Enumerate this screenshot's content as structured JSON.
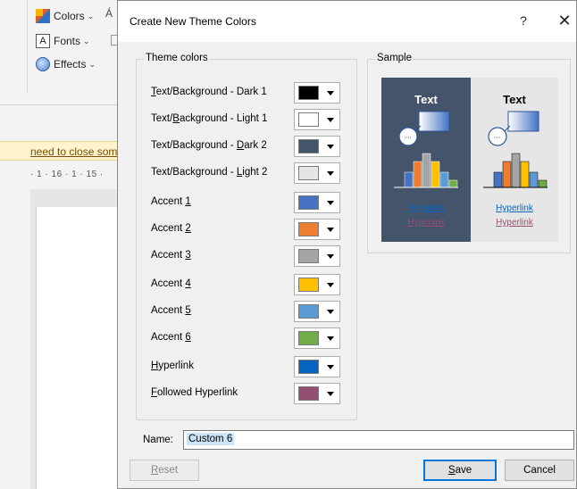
{
  "background_app": {
    "ribbon": {
      "colors_label": "Colors",
      "fonts_label": "Fonts",
      "effects_label": "Effects",
      "colors_icon": "theme-colors-icon",
      "fonts_icon": "theme-fonts-icon",
      "effects_icon": "theme-effects-icon"
    },
    "message_bar_text": "need to close som",
    "ruler_text": "· 1 · 16 · 1 · 15 ·"
  },
  "dialog": {
    "title": "Create New Theme Colors",
    "help_label": "?",
    "close_label": "✕",
    "theme_group_label": "Theme colors",
    "sample_group_label": "Sample",
    "rows": [
      {
        "pre": "",
        "key": "T",
        "post": "ext/Background - Dark 1",
        "color": "#000000"
      },
      {
        "pre": "Text/",
        "key": "B",
        "post": "ackground - Light 1",
        "color": "#ffffff"
      },
      {
        "pre": "Text/Background - ",
        "key": "D",
        "post": "ark 2",
        "color": "#44546a"
      },
      {
        "pre": "Text/Background - ",
        "key": "L",
        "post": "ight 2",
        "color": "#e7e6e6"
      },
      {
        "pre": "Accent ",
        "key": "1",
        "post": "",
        "color": "#4472c4"
      },
      {
        "pre": "Accent ",
        "key": "2",
        "post": "",
        "color": "#ed7d31"
      },
      {
        "pre": "Accent ",
        "key": "3",
        "post": "",
        "color": "#a5a5a5"
      },
      {
        "pre": "Accent ",
        "key": "4",
        "post": "",
        "color": "#ffc000"
      },
      {
        "pre": "Accent ",
        "key": "5",
        "post": "",
        "color": "#5b9bd5"
      },
      {
        "pre": "Accent ",
        "key": "6",
        "post": "",
        "color": "#70ad47"
      },
      {
        "pre": "",
        "key": "H",
        "post": "yperlink",
        "color": "#0563c1"
      },
      {
        "pre": "",
        "key": "F",
        "post": "ollowed Hyperlink",
        "color": "#954f72"
      }
    ],
    "sample": {
      "dark_text": "Text",
      "light_text": "Text",
      "hyperlink": "Hyperlink",
      "followed_hyperlink": "Hyperlink",
      "dark_bg": "#44546a",
      "light_bg": "#e7e6e6",
      "bar_colors": [
        "#4472c4",
        "#ed7d31",
        "#a5a5a5",
        "#ffc000",
        "#5b9bd5",
        "#70ad47"
      ],
      "bar_values": [
        0.45,
        0.75,
        1.0,
        0.75,
        0.45,
        0.2
      ]
    },
    "name_label": "Name:",
    "name_value": "Custom 6",
    "reset_label": "Reset",
    "reset_key": "R",
    "reset_rest": "eset",
    "save_key": "S",
    "save_rest": "ave",
    "cancel_label": "Cancel"
  }
}
